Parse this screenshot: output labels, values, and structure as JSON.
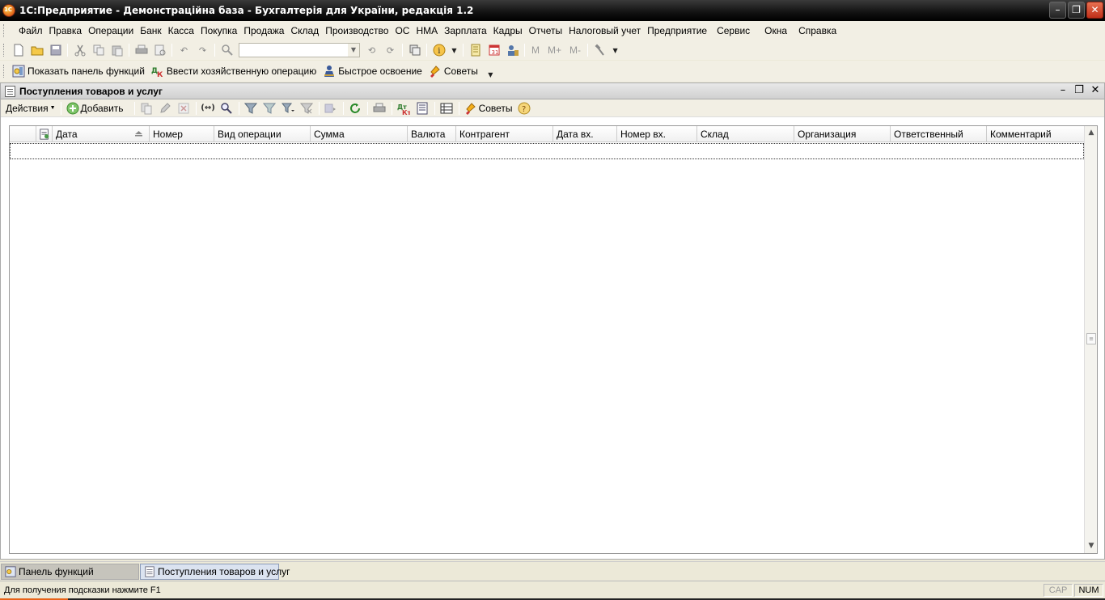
{
  "window": {
    "title": "1С:Предприятие - Демонстраційна база - Бухгалтерія для України, редакція 1.2",
    "controls": [
      "minimize",
      "restore",
      "close"
    ]
  },
  "menubar": {
    "items": [
      "Файл",
      "Правка",
      "Операции",
      "Банк",
      "Касса",
      "Покупка",
      "Продажа",
      "Склад",
      "Производство",
      "ОС",
      "НМА",
      "Зарплата",
      "Кадры",
      "Отчеты",
      "Налоговый учет",
      "Предприятие",
      "Сервис",
      "Окна",
      "Справка"
    ]
  },
  "toolbar": {
    "search_value": "",
    "m_labels": [
      "M",
      "M+",
      "M-"
    ]
  },
  "function_toolbar": {
    "show_panel": "Показать панель функций",
    "enter_operation": "Ввести хозяйственную операцию",
    "quick_start": "Быстрое освоение",
    "tips": "Советы"
  },
  "document": {
    "title": "Поступления товаров и услуг",
    "toolbar": {
      "actions": "Действия",
      "add": "Добавить",
      "tips": "Советы"
    },
    "columns": [
      "Дата",
      "Номер",
      "Вид операции",
      "Сумма",
      "Валюта",
      "Контрагент",
      "Дата вх.",
      "Номер вх.",
      "Склад",
      "Организация",
      "Ответственный",
      "Комментарий"
    ],
    "rows": []
  },
  "taskbar": {
    "tabs": [
      "Панель функций",
      "Поступления товаров и услуг"
    ],
    "active": "Поступления товаров и услуг"
  },
  "statusbar": {
    "hint": "Для получения подсказки нажмите F1",
    "indicators": [
      "CAP",
      "NUM"
    ]
  },
  "colors": {
    "titlebar": "#111111",
    "panel": "#f2efe4",
    "close_button": "#c0301a",
    "active_tab": "#dbe3f0"
  }
}
